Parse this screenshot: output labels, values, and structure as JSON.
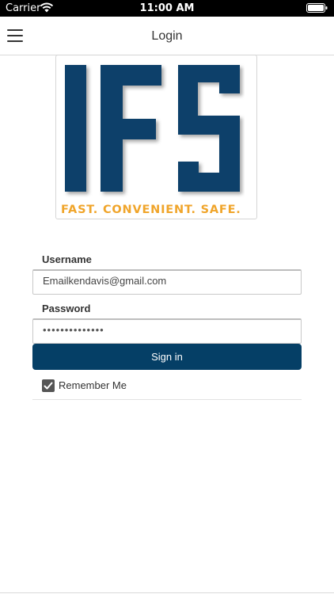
{
  "status_bar": {
    "carrier": "Carrier",
    "time": "11:00 AM"
  },
  "nav": {
    "title": "Login"
  },
  "logo": {
    "letters": "IFS",
    "tagline": "FAST. CONVENIENT. SAFE.",
    "brand_color": "#073f6b",
    "tagline_color": "#f0a52b"
  },
  "form": {
    "username_label": "Username",
    "username_value": "Emailkendavis@gmail.com",
    "password_label": "Password",
    "password_value": "••••••••••••••",
    "signin_label": "Sign in",
    "remember_label": "Remember Me",
    "remember_checked": true
  },
  "colors": {
    "button": "#053f66",
    "status_bar": "#000000"
  }
}
